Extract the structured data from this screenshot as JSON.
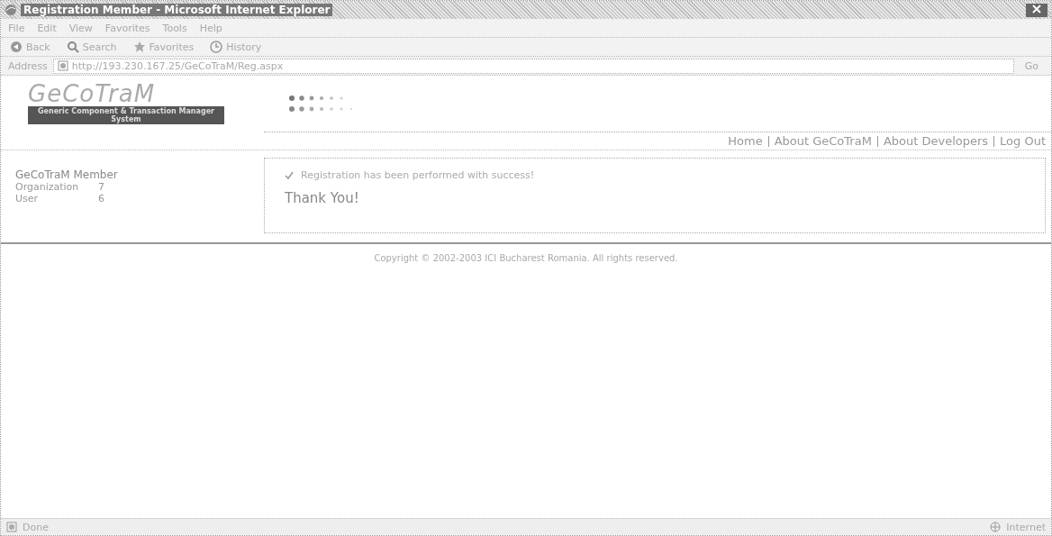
{
  "window": {
    "title": "Registration Member - Microsoft Internet Explorer"
  },
  "menu": [
    "File",
    "Edit",
    "View",
    "Favorites",
    "Tools",
    "Help"
  ],
  "toolbar": [
    {
      "kind": "back",
      "label": "Back"
    },
    {
      "kind": "search",
      "label": "Search"
    },
    {
      "kind": "favorites",
      "label": "Favorites"
    },
    {
      "kind": "history",
      "label": "History"
    }
  ],
  "address": {
    "label": "Address",
    "value": "http://193.230.167.25/GeCoTraM/Reg.aspx",
    "go": "Go"
  },
  "site": {
    "logo": "GeCoTraM",
    "tagline": "Generic Component & Transaction Manager System",
    "nav": [
      "Home",
      "About GeCoTraM",
      "About Developers",
      "Log Out"
    ],
    "member": {
      "title": "GeCoTraM Member",
      "rows": [
        {
          "label": "Organization",
          "value": "7"
        },
        {
          "label": "User",
          "value": "6"
        }
      ]
    },
    "message": "Registration has been performed with success!",
    "thanks": "Thank You!",
    "footer": "Copyright © 2002-2003 ICI Bucharest Romania. All rights reserved."
  },
  "status_bar": {
    "text": "Done",
    "zone": "Internet"
  }
}
